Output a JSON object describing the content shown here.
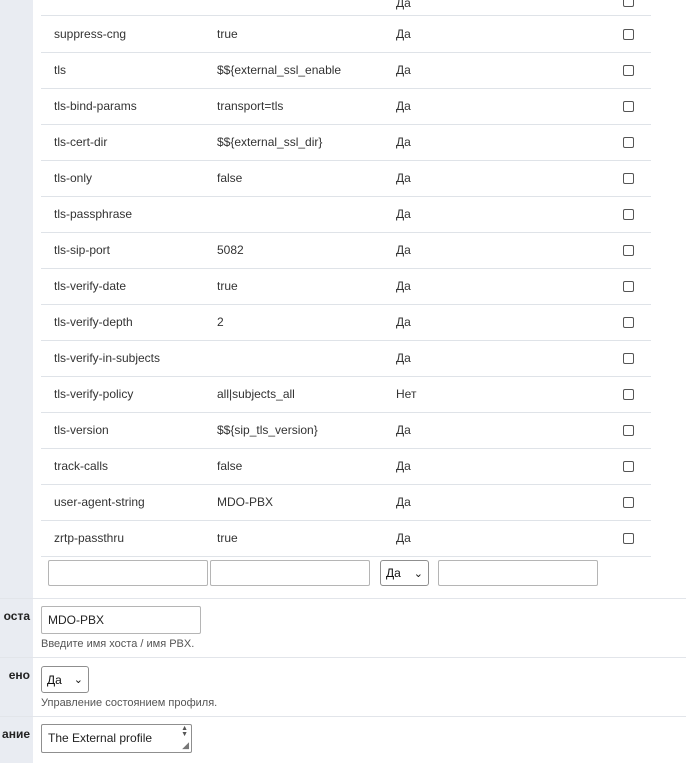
{
  "rows": [
    {
      "name": "",
      "value": "",
      "enabled": "Да"
    },
    {
      "name": "suppress-cng",
      "value": "true",
      "enabled": "Да"
    },
    {
      "name": "tls",
      "value": "$${external_ssl_enable",
      "enabled": "Да"
    },
    {
      "name": "tls-bind-params",
      "value": "transport=tls",
      "enabled": "Да"
    },
    {
      "name": "tls-cert-dir",
      "value": "$${external_ssl_dir}",
      "enabled": "Да"
    },
    {
      "name": "tls-only",
      "value": "false",
      "enabled": "Да"
    },
    {
      "name": "tls-passphrase",
      "value": "",
      "enabled": "Да"
    },
    {
      "name": "tls-sip-port",
      "value": "5082",
      "enabled": "Да"
    },
    {
      "name": "tls-verify-date",
      "value": "true",
      "enabled": "Да"
    },
    {
      "name": "tls-verify-depth",
      "value": "2",
      "enabled": "Да"
    },
    {
      "name": "tls-verify-in-subjects",
      "value": "",
      "enabled": "Да"
    },
    {
      "name": "tls-verify-policy",
      "value": "all|subjects_all",
      "enabled": "Нет"
    },
    {
      "name": "tls-version",
      "value": "$${sip_tls_version}",
      "enabled": "Да"
    },
    {
      "name": "track-calls",
      "value": "false",
      "enabled": "Да"
    },
    {
      "name": "user-agent-string",
      "value": "MDO-PBX",
      "enabled": "Да"
    },
    {
      "name": "zrtp-passthru",
      "value": "true",
      "enabled": "Да"
    }
  ],
  "new_row": {
    "name_value": "",
    "value_value": "",
    "enabled_selected": "Да",
    "description_value": ""
  },
  "hostname": {
    "label": "оста",
    "value": "MDO-PBX",
    "help": "Введите имя хоста / имя PBX."
  },
  "enabled_field": {
    "label": "ено",
    "selected": "Да",
    "help": "Управление состоянием профиля."
  },
  "description_field": {
    "label": "ание",
    "value": "The External profile"
  }
}
